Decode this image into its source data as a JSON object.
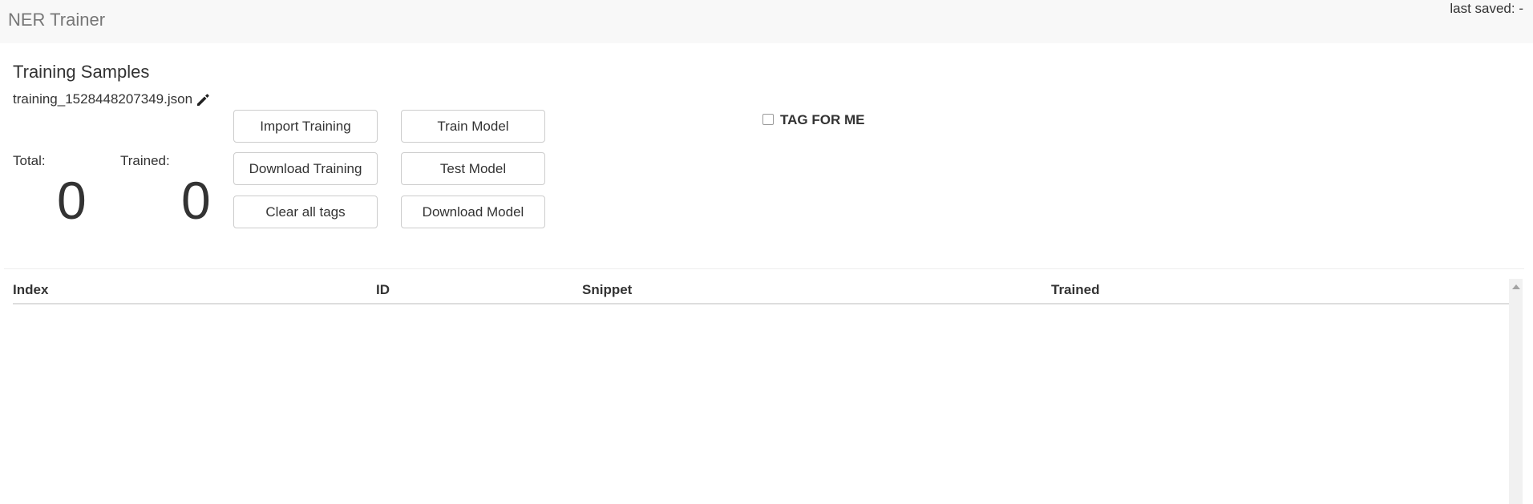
{
  "navbar": {
    "brand": "NER Trainer",
    "last_saved": "last saved: -"
  },
  "training": {
    "title": "Training Samples",
    "filename": "training_1528448207349.json",
    "edit_icon": "pencil-icon",
    "total_label": "Total:",
    "total_value": "0",
    "trained_label": "Trained:",
    "trained_value": "0"
  },
  "buttons": {
    "import_training": "Import Training",
    "download_training": "Download Training",
    "clear_all_tags": "Clear all tags",
    "train_model": "Train Model",
    "test_model": "Test Model",
    "download_model": "Download Model"
  },
  "tag_for_me": {
    "label": "TAG FOR ME",
    "checked": false
  },
  "table": {
    "columns": [
      "Index",
      "ID",
      "Snippet",
      "Trained"
    ],
    "rows": []
  }
}
